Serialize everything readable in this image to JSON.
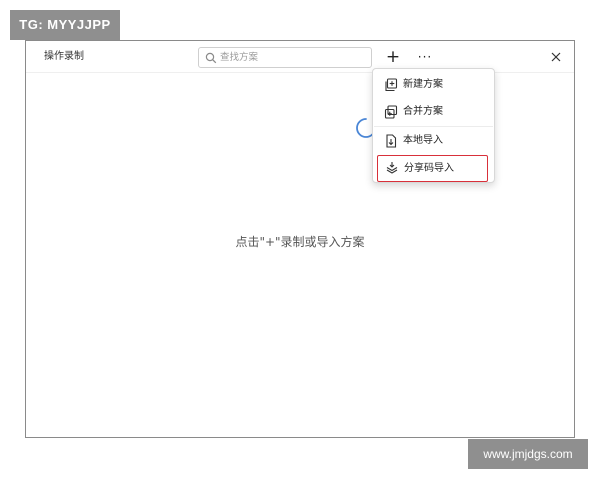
{
  "watermark_top": "TG: MYYJJPP",
  "watermark_bottom": "www.jmjdgs.com",
  "window": {
    "title": "操作录制",
    "search": {
      "placeholder": "查找方案",
      "value": ""
    },
    "add_label": "+",
    "more_label": "···",
    "empty_message": "点击\"+\"录制或导入方案"
  },
  "menu": {
    "items": [
      {
        "label": "新建方案",
        "icon": "new-plan-icon"
      },
      {
        "label": "合并方案",
        "icon": "merge-plan-icon"
      },
      {
        "label": "本地导入",
        "icon": "local-import-icon"
      },
      {
        "label": "分享码导入",
        "icon": "share-code-import-icon"
      }
    ]
  },
  "colors": {
    "highlight_border": "#d8303a",
    "spinner": "#4a86d6"
  }
}
